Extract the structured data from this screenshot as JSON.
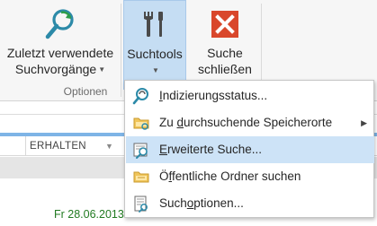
{
  "ribbon": {
    "recent": {
      "line1": "Zuletzt verwendete",
      "line2": "Suchvorgänge",
      "icon": "magnifier-refresh-icon"
    },
    "tools": {
      "line1": "Suchtools",
      "icon": "tools-icon"
    },
    "close": {
      "line1": "Suche",
      "line2": "schließen",
      "icon": "close-x-icon"
    },
    "group_label": "Optionen"
  },
  "list": {
    "column_header": "ERHALTEN",
    "date": "Fr 28.06.2013"
  },
  "menu": {
    "items": [
      {
        "pre": "",
        "ul": "I",
        "post": "ndizierungsstatus...",
        "icon": "indexing-status-icon"
      },
      {
        "pre": "Zu ",
        "ul": "d",
        "post": "urchsuchende Speicherorte",
        "icon": "folder-locations-icon",
        "submenu": true
      },
      {
        "pre": "",
        "ul": "E",
        "post": "rweiterte Suche...",
        "icon": "advanced-search-icon",
        "selected": true
      },
      {
        "pre": "Ö",
        "ul": "f",
        "post": "fentliche Ordner suchen",
        "icon": "public-folder-search-icon"
      },
      {
        "pre": "Such",
        "ul": "o",
        "post": "ptionen...",
        "icon": "search-options-icon"
      }
    ]
  },
  "colors": {
    "accent": "#c5ddf3",
    "close_red": "#d9472b",
    "icon_teal": "#2c8aa8",
    "date_green": "#217a21"
  }
}
